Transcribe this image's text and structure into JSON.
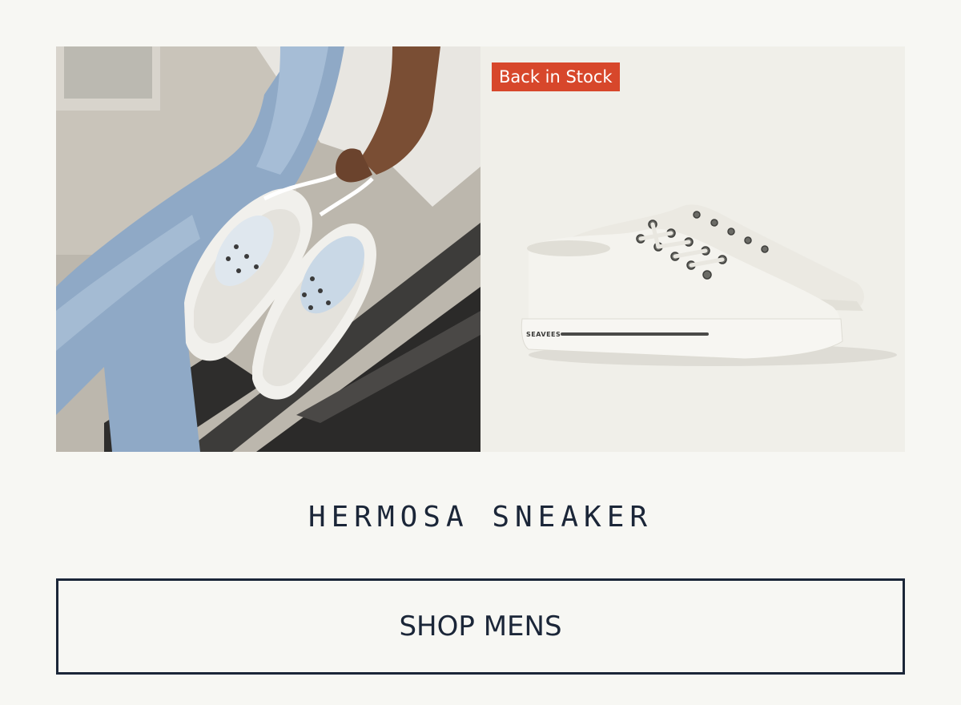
{
  "hero": {
    "lifestyle_image": "lifestyle-photo-person-holding-white-sneakers",
    "product_image": "white-canvas-sneakers-product-shot",
    "badge_text": "Back in Stock",
    "product_brand_print": "SEAVEES"
  },
  "product": {
    "title": "HERMOSA SNEAKER"
  },
  "cta": {
    "label": "SHOP MENS"
  },
  "colors": {
    "background": "#f7f7f3",
    "badge": "#d7472b",
    "navy": "#1b2638"
  }
}
